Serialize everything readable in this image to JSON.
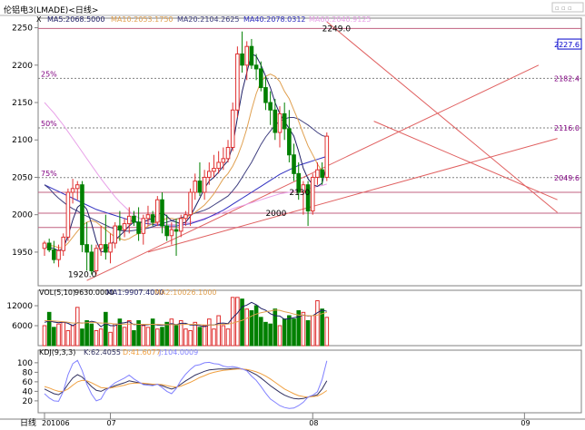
{
  "chart_data": [
    {
      "type": "candlestick",
      "title": "伦铝电3(LMADE)<日线>",
      "series_labels": {
        "x": "X",
        "ma5": "MA5:2068.5000",
        "ma10": "MA10:2053.1750",
        "ma20": "MA20:2104.2625",
        "ma40": "MA40:2078.0312",
        "ma60": "MA60:2040.9125"
      },
      "ylim": [
        1905,
        2258
      ],
      "yticks": [
        "2250",
        "2200",
        "2150",
        "2100",
        "2050",
        "2000",
        "1950"
      ],
      "ytick_values": [
        2250,
        2200,
        2150,
        2100,
        2050,
        2000,
        1950
      ],
      "fib_levels": [
        {
          "pct": "25%",
          "value": 2182.4,
          "label": "2182.4"
        },
        {
          "pct": "50%",
          "value": 2116.0,
          "label": "2116.0"
        },
        {
          "pct": "75%",
          "value": 2049.6,
          "label": "2049.6"
        }
      ],
      "last_price": {
        "value": 2227.6,
        "label": "2227.6"
      },
      "annotations": [
        {
          "text": "2249.0",
          "x": 59,
          "y": 2249
        },
        {
          "text": "2130",
          "x": 52,
          "y": 2030
        },
        {
          "text": "2000",
          "x": 47,
          "y": 2002
        },
        {
          "text": "1920.0",
          "x": 5,
          "y": 1920
        }
      ],
      "horizontal_lines": [
        2249,
        2030,
        2002,
        1983
      ],
      "trend_lines": [
        {
          "from": [
            9,
            1912
          ],
          "to": [
            105,
            2200
          ]
        },
        {
          "from": [
            60,
            2258
          ],
          "to": [
            109,
            2003
          ]
        },
        {
          "from": [
            22,
            1950
          ],
          "to": [
            109,
            2102
          ]
        },
        {
          "from": [
            70,
            2125
          ],
          "to": [
            109,
            2020
          ]
        }
      ],
      "candles": [
        [
          1955,
          1965,
          1945,
          1962
        ],
        [
          1962,
          1968,
          1950,
          1953
        ],
        [
          1953,
          1965,
          1935,
          1940
        ],
        [
          1940,
          1960,
          1930,
          1952
        ],
        [
          1952,
          1975,
          1945,
          1970
        ],
        [
          1970,
          2035,
          1965,
          2030
        ],
        [
          2030,
          2048,
          2015,
          2035
        ],
        [
          2035,
          2045,
          2020,
          2040
        ],
        [
          2040,
          2045,
          1950,
          1960
        ],
        [
          1960,
          1990,
          1925,
          1950
        ],
        [
          1950,
          1960,
          1920,
          1925
        ],
        [
          1925,
          1960,
          1920,
          1955
        ],
        [
          1955,
          1985,
          1945,
          1960
        ],
        [
          1960,
          2000,
          1940,
          1950
        ],
        [
          1950,
          1975,
          1935,
          1962
        ],
        [
          1962,
          1990,
          1955,
          1985
        ],
        [
          1985,
          2005,
          1965,
          1980
        ],
        [
          1980,
          1995,
          1970,
          1988
        ],
        [
          1988,
          2010,
          1975,
          1998
        ],
        [
          1998,
          2005,
          1985,
          1990
        ],
        [
          1990,
          2010,
          1965,
          1975
        ],
        [
          1975,
          2000,
          1960,
          1995
        ],
        [
          1995,
          2012,
          1985,
          2000
        ],
        [
          2000,
          2005,
          1985,
          1990
        ],
        [
          1990,
          2025,
          1985,
          2020
        ],
        [
          2020,
          2030,
          1975,
          1985
        ],
        [
          1985,
          2000,
          1965,
          1972
        ],
        [
          1972,
          1990,
          1960,
          1980
        ],
        [
          1980,
          1995,
          1945,
          1978
        ],
        [
          1978,
          2000,
          1970,
          1995
        ],
        [
          1995,
          2005,
          1985,
          2000
        ],
        [
          2000,
          2035,
          1985,
          2030
        ],
        [
          2030,
          2055,
          2020,
          2045
        ],
        [
          2045,
          2070,
          2025,
          2030
        ],
        [
          2030,
          2060,
          2020,
          2050
        ],
        [
          2050,
          2070,
          2040,
          2058
        ],
        [
          2058,
          2080,
          2050,
          2062
        ],
        [
          2062,
          2085,
          2055,
          2070
        ],
        [
          2070,
          2090,
          2060,
          2075
        ],
        [
          2075,
          2100,
          2070,
          2090
        ],
        [
          2090,
          2150,
          2085,
          2140
        ],
        [
          2140,
          2225,
          2130,
          2215
        ],
        [
          2215,
          2245,
          2190,
          2200
        ],
        [
          2200,
          2232,
          2180,
          2225
        ],
        [
          2225,
          2235,
          2195,
          2200
        ],
        [
          2200,
          2215,
          2180,
          2195
        ],
        [
          2195,
          2205,
          2165,
          2170
        ],
        [
          2170,
          2185,
          2140,
          2150
        ],
        [
          2150,
          2165,
          2120,
          2140
        ],
        [
          2140,
          2155,
          2100,
          2110
        ],
        [
          2110,
          2145,
          2090,
          2135
        ],
        [
          2135,
          2150,
          2100,
          2115
        ],
        [
          2115,
          2140,
          2070,
          2080
        ],
        [
          2080,
          2095,
          2045,
          2055
        ],
        [
          2055,
          2070,
          2020,
          2030
        ],
        [
          2030,
          2045,
          2000,
          2040
        ],
        [
          2040,
          2045,
          1985,
          2005
        ],
        [
          2005,
          2055,
          2000,
          2050
        ],
        [
          2050,
          2070,
          2040,
          2060
        ],
        [
          2060,
          2070,
          2040,
          2050
        ],
        [
          2050,
          2110,
          2045,
          2105
        ]
      ],
      "moving_averages": {
        "ma5": [
          1958,
          1956,
          1955,
          1952,
          1955,
          1972,
          1993,
          2010,
          2015,
          2007,
          1988,
          1965,
          1950,
          1952,
          1960,
          1966,
          1972,
          1978,
          1985,
          1990,
          1990,
          1990,
          1993,
          1995,
          2000,
          2003,
          1998,
          1992,
          1990,
          1988,
          1990,
          1998,
          2010,
          2022,
          2035,
          2045,
          2050,
          2057,
          2065,
          2072,
          2092,
          2130,
          2165,
          2190,
          2215,
          2212,
          2200,
          2185,
          2170,
          2150,
          2135,
          2125,
          2115,
          2105,
          2085,
          2062,
          2048,
          2040,
          2038,
          2042,
          2068
        ],
        "ma10": [
          1960,
          1959,
          1958,
          1956,
          1956,
          1962,
          1970,
          1978,
          1985,
          1990,
          1992,
          1990,
          1985,
          1980,
          1975,
          1970,
          1968,
          1966,
          1968,
          1972,
          1975,
          1980,
          1985,
          1988,
          1990,
          1993,
          1995,
          1995,
          1994,
          1995,
          1996,
          2000,
          2003,
          2008,
          2013,
          2020,
          2028,
          2038,
          2048,
          2055,
          2065,
          2078,
          2095,
          2115,
          2140,
          2162,
          2178,
          2185,
          2188,
          2185,
          2178,
          2165,
          2155,
          2140,
          2125,
          2108,
          2092,
          2080,
          2068,
          2058,
          2053
        ],
        "ma20": [
          2040,
          2035,
          2028,
          2022,
          2017,
          2012,
          2008,
          2005,
          2001,
          1998,
          1995,
          1992,
          1989,
          1986,
          1983,
          1981,
          1979,
          1978,
          1978,
          1979,
          1980,
          1981,
          1982,
          1984,
          1986,
          1988,
          1990,
          1992,
          1994,
          1996,
          1998,
          2000,
          2002,
          2004,
          2006,
          2009,
          2013,
          2017,
          2021,
          2025,
          2032,
          2040,
          2050,
          2060,
          2070,
          2082,
          2094,
          2104,
          2112,
          2120,
          2125,
          2128,
          2130,
          2130,
          2128,
          2124,
          2120,
          2115,
          2110,
          2106,
          2104
        ],
        "ma40": [
          2040,
          2037,
          2034,
          2031,
          2028,
          2025,
          2022,
          2019,
          2016,
          2013,
          2010,
          2007,
          2005,
          2003,
          2001,
          1999,
          1997,
          1995,
          1993,
          1991,
          1990,
          1989,
          1988,
          1987,
          1986,
          1986,
          1985,
          1985,
          1985,
          1986,
          1987,
          1988,
          1990,
          1992,
          1994,
          1997,
          2000,
          2003,
          2006,
          2010,
          2014,
          2018,
          2022,
          2026,
          2030,
          2034,
          2038,
          2042,
          2046,
          2050,
          2054,
          2057,
          2060,
          2063,
          2066,
          2068,
          2070,
          2072,
          2074,
          2076,
          2078
        ],
        "ma60": [
          2150,
          2143,
          2136,
          2128,
          2120,
          2111,
          2102,
          2093,
          2084,
          2075,
          2066,
          2057,
          2048,
          2040,
          2032,
          2024,
          2017,
          2011,
          2005,
          2000,
          1996,
          1993,
          1991,
          1989,
          1988,
          1987,
          1987,
          1987,
          1987,
          1988,
          1989,
          1990,
          1991,
          1993,
          1995,
          1997,
          1999,
          2001,
          2003,
          2005,
          2008,
          2010,
          2012,
          2014,
          2016,
          2018,
          2020,
          2022,
          2024,
          2026,
          2028,
          2029,
          2030,
          2032,
          2033,
          2034,
          2035,
          2036,
          2038,
          2039,
          2041
        ]
      }
    },
    {
      "type": "bar",
      "title": "VOL(5,10)",
      "series_labels": {
        "vol": "9630.0000",
        "ma1": "MA1:9907.4000",
        "ma2": "MA2:10026.1000"
      },
      "ylim": [
        0,
        15000
      ],
      "yticks": [
        "12000",
        "6000"
      ],
      "ytick_values": [
        12000,
        6000
      ],
      "volumes": [
        6000,
        10000,
        5500,
        6500,
        7000,
        4500,
        6000,
        11500,
        5000,
        7500,
        6500,
        4500,
        5000,
        10000,
        4000,
        6500,
        8000,
        5500,
        7500,
        4500,
        7500,
        6000,
        5500,
        8000,
        5000,
        5500,
        7000,
        8000,
        6000,
        7500,
        5000,
        4500,
        7000,
        5500,
        6000,
        8000,
        5000,
        9000,
        6000,
        5000,
        14500,
        14500,
        14000,
        11000,
        10500,
        12000,
        8500,
        7000,
        6500,
        11000,
        6000,
        8000,
        9000,
        8000,
        10500,
        10000,
        7500,
        9000,
        13500,
        11000,
        8500
      ],
      "ma1": [
        7000,
        7400,
        7100,
        6900,
        7100,
        6700,
        6000,
        6900,
        6800,
        6900,
        7300,
        7000,
        5700,
        6700,
        6000,
        6000,
        6700,
        6900,
        7200,
        6300,
        6400,
        6200,
        6300,
        6500,
        6200,
        6100,
        6300,
        6600,
        6300,
        6700,
        6700,
        6200,
        6200,
        6000,
        5700,
        6200,
        6200,
        6700,
        6800,
        6600,
        8400,
        9800,
        11700,
        12200,
        13000,
        12300,
        11200,
        10600,
        9600,
        9000,
        8900,
        7900,
        8100,
        8400,
        8700,
        9200,
        8900,
        9000,
        9900,
        10700,
        10300
      ],
      "ma2": [
        7500,
        7500,
        7400,
        7300,
        7200,
        7000,
        6800,
        6800,
        6800,
        6900,
        7000,
        6900,
        6800,
        6800,
        6700,
        6500,
        6400,
        6500,
        6500,
        6500,
        6400,
        6400,
        6400,
        6400,
        6400,
        6300,
        6300,
        6300,
        6300,
        6300,
        6400,
        6400,
        6400,
        6300,
        6200,
        6200,
        6200,
        6300,
        6400,
        6500,
        6800,
        7200,
        7600,
        8200,
        8900,
        9500,
        9900,
        10200,
        10400,
        10700,
        10600,
        10200,
        9900,
        9500,
        9200,
        9100,
        9000,
        9000,
        9200,
        9600,
        10000
      ]
    },
    {
      "type": "line",
      "title": "KDJ(9,3,3)",
      "series_labels": {
        "k": "K:62.4055",
        "d": "D:41.6077",
        "j": "J:104.0009"
      },
      "ylim": [
        -5,
        115
      ],
      "yticks": [
        "100",
        "80",
        "60",
        "40",
        "20"
      ],
      "ytick_values": [
        100,
        80,
        60,
        40,
        20
      ],
      "k": [
        45,
        40,
        35,
        33,
        40,
        55,
        68,
        75,
        70,
        60,
        50,
        42,
        40,
        45,
        48,
        52,
        55,
        58,
        62,
        60,
        58,
        56,
        55,
        54,
        55,
        52,
        48,
        45,
        48,
        55,
        62,
        68,
        74,
        78,
        82,
        85,
        86,
        87,
        87,
        87,
        88,
        88,
        87,
        85,
        80,
        75,
        68,
        60,
        52,
        45,
        38,
        32,
        28,
        25,
        24,
        25,
        28,
        30,
        33,
        45,
        62
      ],
      "d": [
        50,
        47,
        43,
        40,
        40,
        45,
        53,
        60,
        63,
        62,
        58,
        53,
        48,
        47,
        47,
        49,
        51,
        53,
        56,
        57,
        57,
        57,
        56,
        55,
        55,
        54,
        52,
        50,
        49,
        51,
        55,
        59,
        64,
        69,
        73,
        77,
        80,
        82,
        84,
        85,
        86,
        87,
        87,
        86,
        84,
        81,
        77,
        72,
        66,
        59,
        52,
        45,
        40,
        35,
        31,
        29,
        28,
        29,
        30,
        35,
        41.6
      ],
      "j": [
        35,
        26,
        20,
        19,
        40,
        75,
        98,
        105,
        84,
        55,
        34,
        20,
        24,
        41,
        50,
        58,
        63,
        68,
        74,
        66,
        60,
        54,
        53,
        52,
        55,
        48,
        40,
        35,
        46,
        63,
        76,
        86,
        94,
        96,
        100,
        101,
        98,
        97,
        93,
        91,
        92,
        90,
        87,
        83,
        72,
        63,
        50,
        36,
        24,
        17,
        10,
        6,
        4,
        5,
        10,
        17,
        28,
        32,
        39,
        65,
        104
      ]
    }
  ],
  "x_axis": {
    "prefix": "日线",
    "labels": [
      {
        "text": "201006",
        "index": 0
      },
      {
        "text": "07",
        "index": 14
      },
      {
        "text": "08",
        "index": 57
      },
      {
        "text": "09",
        "index": 102
      }
    ]
  },
  "colors": {
    "up": "#e03030",
    "down": "#008000",
    "ma5": "#1f1f66",
    "ma10": "#e0a050",
    "ma20": "#404080",
    "ma40": "#3030c0",
    "ma60": "#e8a0e8",
    "trend": "#e06060",
    "hline": "#c06080",
    "fib": "#808080",
    "kdj_k": "#303060",
    "kdj_d": "#f0a040",
    "kdj_j": "#8080ff",
    "accent": "#0000cc"
  }
}
